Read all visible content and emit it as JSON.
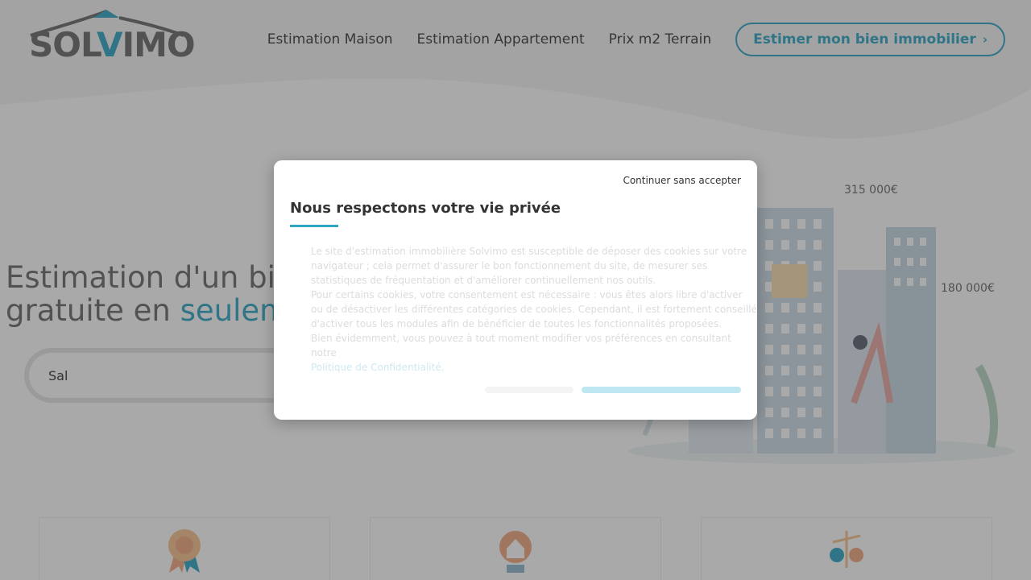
{
  "header": {
    "logo_text_start": "SOL",
    "logo_text_v": "V",
    "logo_text_end": "IMO",
    "nav": [
      {
        "label": "Estimation Maison"
      },
      {
        "label": "Estimation Appartement"
      },
      {
        "label": "Prix m2 Terrain"
      }
    ],
    "cta_label": "Estimer mon bien immobilier",
    "cta_icon": "chevron-right-icon"
  },
  "hero": {
    "title_line1": "Estimation d'un bie",
    "title_line2_start": "gratuite en ",
    "title_line2_accent": "seulem",
    "search_value": "Sal",
    "prices": [
      "315 000€",
      "180 000€"
    ]
  },
  "cards": {
    "icons": [
      "award-icon",
      "house-seal-icon",
      "scale-coins-icon"
    ]
  },
  "modal": {
    "skip_label": "Continuer sans accepter",
    "title": "Nous respectons votre vie privée",
    "paragraph1": "Le site d'estimation immobilière Solvimo est susceptible de déposer des cookies sur votre navigateur ; cela permet d'assurer le bon fonctionnement du site, de mesurer ses statistiques de fréquentation et d'améliorer continuellement nos outils.",
    "paragraph2": "Pour certains cookies, votre consentement est nécessaire : vous êtes alors libre d'activer ou de désactiver les différentes catégories de cookies. Cependant, il est fortement conseillé d'activer tous les modules afin de bénéficier de toutes les fonctionnalités proposées.",
    "paragraph3": "Bien évidemment, vous pouvez à tout moment modifier vos préférences en consultant notre",
    "policy_link": "Politique de Confidentialité.",
    "params_label": "",
    "accept_label": ""
  },
  "colors": {
    "accent": "#2fa6c4",
    "text_dark": "#333333",
    "logo_gray": "#6a6a6a"
  }
}
